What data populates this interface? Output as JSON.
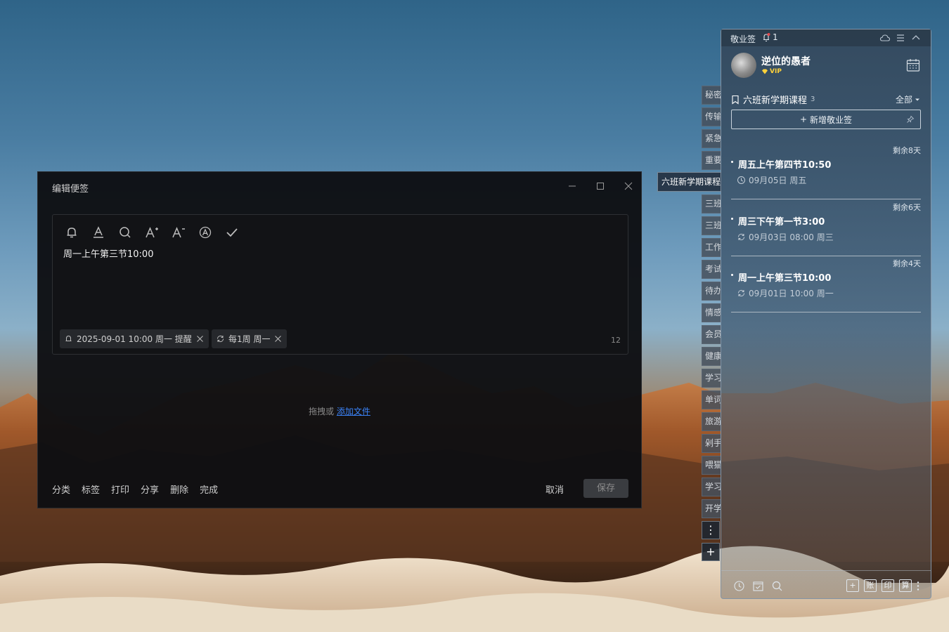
{
  "editor": {
    "title": "编辑便签",
    "note_text": "周一上午第三节10:00",
    "reminder_chip": "2025-09-01 10:00 周一 提醒",
    "repeat_chip": "每1周 周一",
    "char_count": "12",
    "drop_text": "拖拽或",
    "drop_link": "添加文件",
    "actions": [
      "分类",
      "标签",
      "打印",
      "分享",
      "删除",
      "完成"
    ],
    "cancel_label": "取消",
    "save_label": "保存",
    "toolbar_icons": [
      "bell-icon",
      "text-color-icon",
      "search-icon",
      "font-increase-icon",
      "font-decrease-icon",
      "auto-format-icon",
      "check-icon"
    ]
  },
  "side_tabs": {
    "active": "六班新学期课程",
    "items": [
      "秘密",
      "传输",
      "紧急",
      "重要",
      "三班",
      "三班",
      "工作",
      "考试",
      "待办",
      "情感",
      "会员",
      "健康",
      "学习",
      "单词",
      "旅游",
      "剁手",
      "喂猫",
      "学习",
      "开学"
    ],
    "more_label": "⋮",
    "add_label": "+"
  },
  "panel": {
    "app_title": "敬业签",
    "notification_count": "1",
    "username": "逆位的愚者",
    "vip_label": "VIP",
    "category": "六班新学期课程",
    "category_count": "3",
    "filter_label": "全部",
    "add_button_label": "新增敬业签",
    "notes": [
      {
        "remaining": "剩余8天",
        "title": "周五上午第四节10:50",
        "meta": "09月05日 周五",
        "icon": "clock-icon"
      },
      {
        "remaining": "剩余6天",
        "title": "周三下午第一节3:00",
        "meta": "09月03日 08:00 周三",
        "icon": "repeat-icon"
      },
      {
        "remaining": "剩余4天",
        "title": "周一上午第三节10:00",
        "meta": "09月01日 10:00 周一",
        "icon": "repeat-icon"
      }
    ],
    "footer_boxes": [
      "+",
      "账",
      "印",
      "算"
    ]
  },
  "colors": {
    "editor_bg": "#0e0f12",
    "link": "#3b82f6",
    "vip": "#ffd23a"
  }
}
